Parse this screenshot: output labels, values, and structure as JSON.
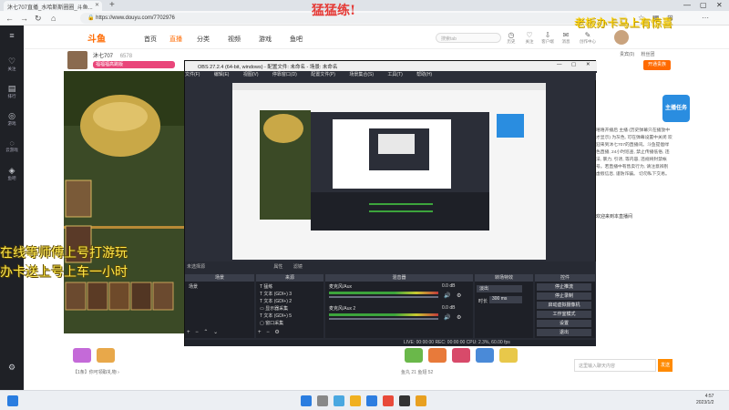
{
  "browser": {
    "tab1_title": "沐七707直播_水哈斯斯圈圈_斗鱼...",
    "tab2_title": "",
    "url": "https://www.douyu.com/7702976",
    "url_short": "www.douyu.com"
  },
  "overlays": {
    "top_center": "猛猛练!",
    "top_right": "老板办卡马上有惊喜",
    "video_lines": [
      "在线等师傅上号打游玩",
      "办卡送上号上车一小时"
    ]
  },
  "site": {
    "logo_text": "斗鱼",
    "nav": [
      "首页",
      "直播",
      "分类",
      "视频",
      "游戏",
      "鱼吧"
    ],
    "search_placeholder": "搜索tab",
    "header_icons": [
      "历史",
      "关注",
      "客户端",
      "消息",
      "创作中心"
    ]
  },
  "sidebar": [
    {
      "icon": "♡",
      "label": "关注"
    },
    {
      "icon": "▤",
      "label": "排行"
    },
    {
      "icon": "◎",
      "label": "游戏"
    },
    {
      "icon": "◌",
      "label": "云游戏"
    },
    {
      "icon": "◈",
      "label": "鱼吧"
    }
  ],
  "room": {
    "streamer_name": "沐七707",
    "room_id": "6578",
    "badge_text": "福福福高跳版",
    "follow_label": "开通贵族",
    "tabs": [
      "贵宾(0)",
      "粉丝团"
    ]
  },
  "obs": {
    "title": "OBS 27.2.4 (64-bit, windows) - 配置文件: 未命名 - 场景: 未命名",
    "menu": [
      "文件(F)",
      "编辑(E)",
      "视图(V)",
      "停靠窗口(D)",
      "配置文件(P)",
      "场景集合(S)",
      "工具(T)",
      "帮助(H)"
    ],
    "dock_headers": [
      "场景",
      "来源",
      "混音器",
      "转场特效",
      "控件"
    ],
    "scene_name": "场景",
    "sources": [
      "猛练",
      "文本 (GDI+) 3",
      "文本 (GDI+) 2",
      "显示器采集",
      "文本 (GDI+) 5",
      "窗口采集"
    ],
    "mixer": [
      {
        "label": "麦克风/Aux",
        "value": "0.0 dB"
      },
      {
        "label": "麦克风/Aux 2",
        "value": "0.0 dB"
      }
    ],
    "transition": {
      "type": "淡出",
      "duration_label": "时长",
      "duration": "300 ms"
    },
    "controls": [
      "停止推流",
      "停止录制",
      "启动虚拟摄像机",
      "工作室模式",
      "设置",
      "退出"
    ],
    "status": "LIVE: 00:00:00   REC: 00:00:00   CPU: 2.3%, 60.00 fps",
    "selected_label": "未选择源",
    "props_label": "属性",
    "filters_label": "滤镜"
  },
  "chat": {
    "promo": "主播任务",
    "messages": "嘻嘻开播后 主播 (历史弹幕只在播放中才显示) 为灰色, 可在弹幕设置中关闭 欢迎来到沐七707的直播间。斗鱼提倡绿色直播, 24小时巡查, 禁止传播低俗, 违法, 暴力, 引诱, 等内容, 违规将封禁帐号。若直播中有售卖行为, 请注意辨别虚假信息, 谨防诈骗。 切勿私下交易。",
    "welcome": "欢迎来到本直播间",
    "input_placeholder": "这里输入聊天内容",
    "send_label": "发送"
  },
  "gift_bar": {
    "notice": "【1条】你可领取礼物 ›",
    "stats": "鱼丸 21    鱼翅 52"
  },
  "taskbar": {
    "time": "4:57",
    "date": "2023/1/2"
  },
  "colors": {
    "accent": "#ff6a00",
    "obs_bg": "#2b2e38",
    "overlay_yellow": "#ffe84a",
    "overlay_red": "#e53935"
  }
}
